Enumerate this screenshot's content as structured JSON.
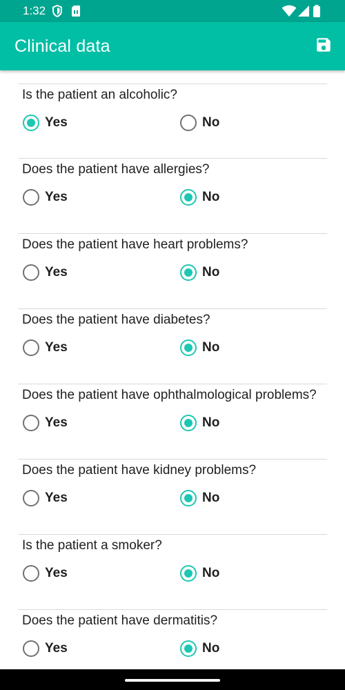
{
  "status_bar": {
    "time": "1:32",
    "icons": [
      "shield-icon",
      "sim-card-icon",
      "wifi-icon",
      "signal-icon",
      "battery-icon"
    ],
    "color": "#00a58f"
  },
  "app_bar": {
    "title": "Clinical data",
    "action_icon": "save-icon",
    "color": "#00bfa5"
  },
  "accent_color": "#1dc7b3",
  "questions": [
    {
      "text": "Is the patient an alcoholic?",
      "yes_label": "Yes",
      "no_label": "No",
      "selected": "yes"
    },
    {
      "text": "Does the patient have allergies?",
      "yes_label": "Yes",
      "no_label": "No",
      "selected": "no"
    },
    {
      "text": "Does the patient have heart problems?",
      "yes_label": "Yes",
      "no_label": "No",
      "selected": "no"
    },
    {
      "text": "Does the patient have diabetes?",
      "yes_label": "Yes",
      "no_label": "No",
      "selected": "no"
    },
    {
      "text": "Does the patient have ophthalmological problems?",
      "yes_label": "Yes",
      "no_label": "No",
      "selected": "no"
    },
    {
      "text": "Does the patient have kidney problems?",
      "yes_label": "Yes",
      "no_label": "No",
      "selected": "no"
    },
    {
      "text": "Is the patient a smoker?",
      "yes_label": "Yes",
      "no_label": "No",
      "selected": "no"
    },
    {
      "text": "Does the patient have dermatitis?",
      "yes_label": "Yes",
      "no_label": "No",
      "selected": "no"
    }
  ]
}
